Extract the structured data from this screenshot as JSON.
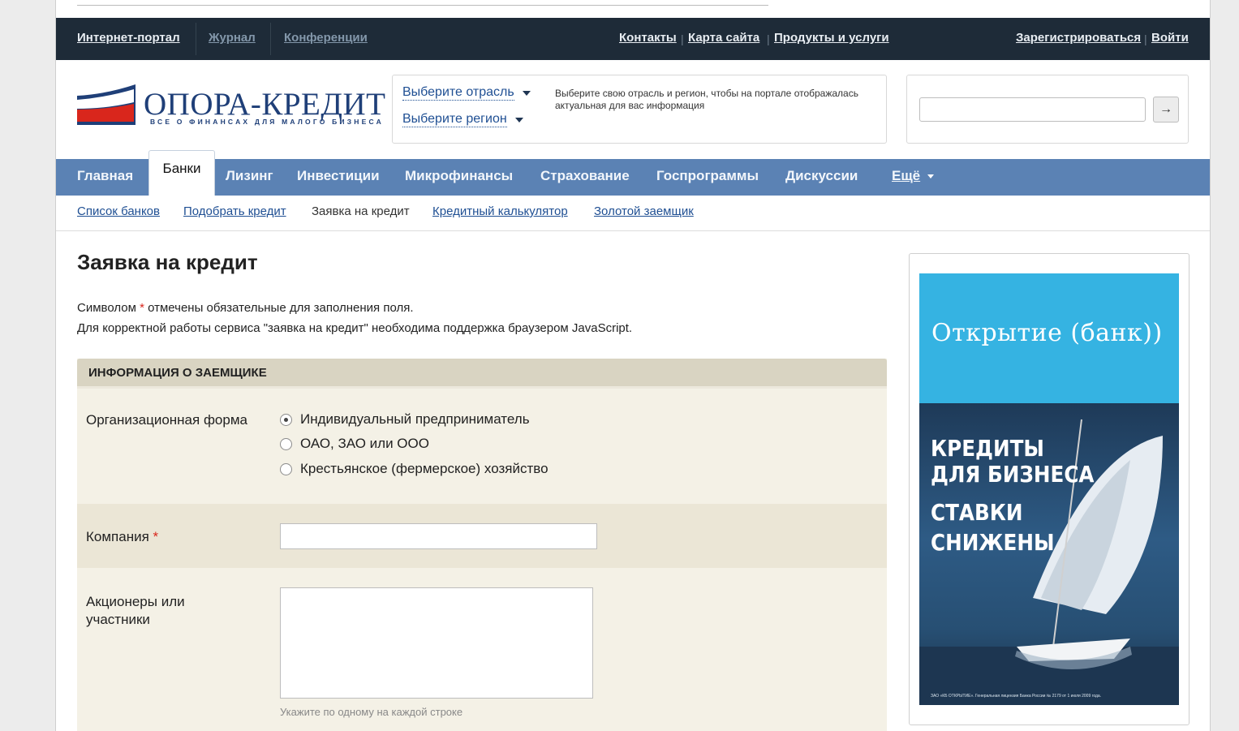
{
  "topbar": {
    "portal": "Интернет-портал",
    "journal": "Журнал",
    "conferences": "Конференции",
    "contacts": "Контакты",
    "sitemap": "Карта сайта",
    "products": "Продукты и услуги",
    "register": "Зарегистрироваться",
    "login": "Войти"
  },
  "logo": {
    "name": "ОПОРА-КРЕДИТ",
    "tagline": "ВСЕ О ФИНАНСАХ ДЛЯ МАЛОГО БИЗНЕСА",
    "flag_colors": [
      "#ffffff",
      "#1f4f93",
      "#d9261c"
    ]
  },
  "selector": {
    "industry": "Выберите отрасль",
    "region": "Выберите регион",
    "hint": "Выберите свою отрасль и регион, чтобы на портале отображалась актуальная для вас информация"
  },
  "search": {
    "value": "",
    "button_icon": "arrow-right-icon"
  },
  "nav": {
    "items": [
      "Главная",
      "Банки",
      "Лизинг",
      "Инвестиции",
      "Микрофинансы",
      "Страхование",
      "Госпрограммы",
      "Дискуссии"
    ],
    "active": "Банки",
    "more": "Ещё"
  },
  "subnav": {
    "bank_list": "Список банков",
    "pick_credit": "Подобрать кредит",
    "current": "Заявка на кредит",
    "calculator": "Кредитный калькулятор",
    "golden": "Золотой заемщик"
  },
  "page": {
    "title": "Заявка на кредит",
    "note1_before": "Символом ",
    "note1_star": "*",
    "note1_after": " отмечены обязательные для заполнения поля.",
    "note2": "Для корректной работы сервиса \"заявка на кредит\" необходима поддержка браузером JavaScript."
  },
  "form": {
    "section": "ИНФОРМАЦИЯ О ЗАЕМЩИКЕ",
    "org_label": "Организационная форма",
    "org_options": [
      "Индивидуальный предприниматель",
      "ОАО, ЗАО или ООО",
      "Крестьянское (фермерское) хозяйство"
    ],
    "org_selected": "Индивидуальный предприниматель",
    "company_label": "Компания",
    "required_star": "*",
    "company_value": "",
    "shareholders_label_1": "Акционеры или",
    "shareholders_label_2": "участники",
    "shareholders_value": "",
    "shareholders_hint": "Укажите по одному на каждой строке"
  },
  "ad": {
    "logo": "Открытие (банк))",
    "line1": "КРЕДИТЫ",
    "line2": "ДЛЯ БИЗНЕСА",
    "line3": "СТАВКИ",
    "line4": "СНИЖЕНЫ",
    "fine_print": "ЗАО «КБ ОТКРЫТИЕ». Генеральная лицензия Банка России № 2179 от 1 июля 2009 года.",
    "colors": {
      "top": "#35b3e2",
      "bottom": "#274f73"
    }
  }
}
